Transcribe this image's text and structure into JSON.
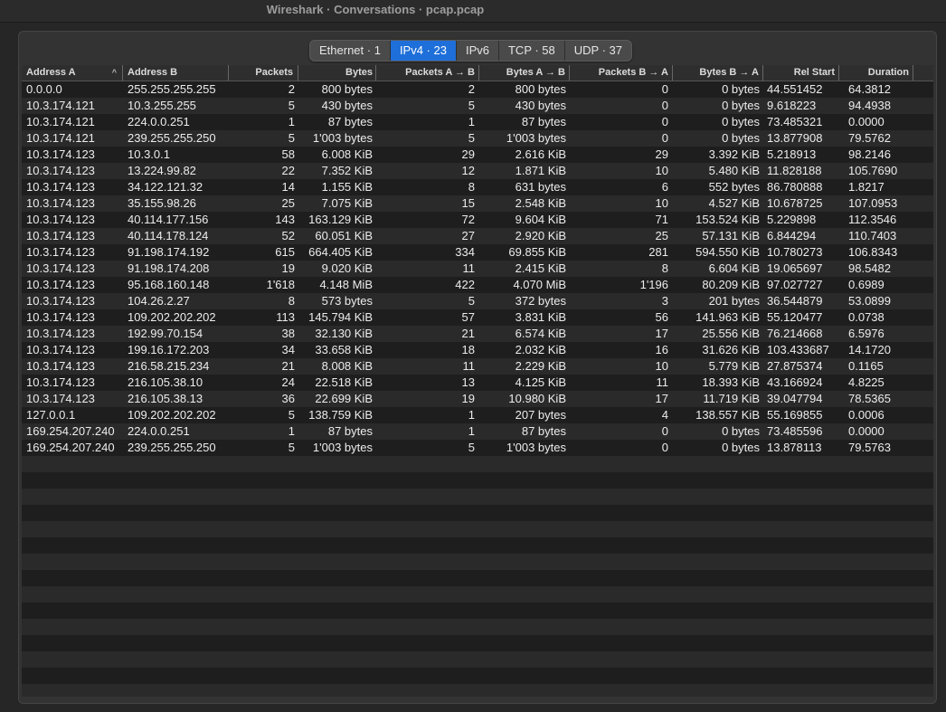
{
  "window": {
    "title": "Wireshark · Conversations · pcap.pcap"
  },
  "tabs": [
    {
      "label": "Ethernet · 1",
      "active": false
    },
    {
      "label": "IPv4 · 23",
      "active": true
    },
    {
      "label": "IPv6",
      "active": false
    },
    {
      "label": "TCP · 58",
      "active": false
    },
    {
      "label": "UDP · 37",
      "active": false
    }
  ],
  "colors": {
    "accent": "#1e6fd9",
    "row_odd": "#1e1e1e",
    "row_even": "#2a2a2a"
  },
  "table": {
    "sort_indicator": "^",
    "columns": [
      "Address A",
      "Address B",
      "Packets",
      "Bytes",
      "Packets A → B",
      "Bytes A → B",
      "Packets B → A",
      "Bytes B → A",
      "Rel Start",
      "Duration"
    ],
    "rows": [
      [
        "0.0.0.0",
        "255.255.255.255",
        "2",
        "800 bytes",
        "2",
        "800 bytes",
        "0",
        "0 bytes",
        "44.551452",
        "64.3812"
      ],
      [
        "10.3.174.121",
        "10.3.255.255",
        "5",
        "430 bytes",
        "5",
        "430 bytes",
        "0",
        "0 bytes",
        "9.618223",
        "94.4938"
      ],
      [
        "10.3.174.121",
        "224.0.0.251",
        "1",
        "87 bytes",
        "1",
        "87 bytes",
        "0",
        "0 bytes",
        "73.485321",
        "0.0000"
      ],
      [
        "10.3.174.121",
        "239.255.255.250",
        "5",
        "1'003 bytes",
        "5",
        "1'003 bytes",
        "0",
        "0 bytes",
        "13.877908",
        "79.5762"
      ],
      [
        "10.3.174.123",
        "10.3.0.1",
        "58",
        "6.008 KiB",
        "29",
        "2.616 KiB",
        "29",
        "3.392 KiB",
        "5.218913",
        "98.2146"
      ],
      [
        "10.3.174.123",
        "13.224.99.82",
        "22",
        "7.352 KiB",
        "12",
        "1.871 KiB",
        "10",
        "5.480 KiB",
        "11.828188",
        "105.7690"
      ],
      [
        "10.3.174.123",
        "34.122.121.32",
        "14",
        "1.155 KiB",
        "8",
        "631 bytes",
        "6",
        "552 bytes",
        "86.780888",
        "1.8217"
      ],
      [
        "10.3.174.123",
        "35.155.98.26",
        "25",
        "7.075 KiB",
        "15",
        "2.548 KiB",
        "10",
        "4.527 KiB",
        "10.678725",
        "107.0953"
      ],
      [
        "10.3.174.123",
        "40.114.177.156",
        "143",
        "163.129 KiB",
        "72",
        "9.604 KiB",
        "71",
        "153.524 KiB",
        "5.229898",
        "112.3546"
      ],
      [
        "10.3.174.123",
        "40.114.178.124",
        "52",
        "60.051 KiB",
        "27",
        "2.920 KiB",
        "25",
        "57.131 KiB",
        "6.844294",
        "110.7403"
      ],
      [
        "10.3.174.123",
        "91.198.174.192",
        "615",
        "664.405 KiB",
        "334",
        "69.855 KiB",
        "281",
        "594.550 KiB",
        "10.780273",
        "106.8343"
      ],
      [
        "10.3.174.123",
        "91.198.174.208",
        "19",
        "9.020 KiB",
        "11",
        "2.415 KiB",
        "8",
        "6.604 KiB",
        "19.065697",
        "98.5482"
      ],
      [
        "10.3.174.123",
        "95.168.160.148",
        "1'618",
        "4.148 MiB",
        "422",
        "4.070 MiB",
        "1'196",
        "80.209 KiB",
        "97.027727",
        "0.6989"
      ],
      [
        "10.3.174.123",
        "104.26.2.27",
        "8",
        "573 bytes",
        "5",
        "372 bytes",
        "3",
        "201 bytes",
        "36.544879",
        "53.0899"
      ],
      [
        "10.3.174.123",
        "109.202.202.202",
        "113",
        "145.794 KiB",
        "57",
        "3.831 KiB",
        "56",
        "141.963 KiB",
        "55.120477",
        "0.0738"
      ],
      [
        "10.3.174.123",
        "192.99.70.154",
        "38",
        "32.130 KiB",
        "21",
        "6.574 KiB",
        "17",
        "25.556 KiB",
        "76.214668",
        "6.5976"
      ],
      [
        "10.3.174.123",
        "199.16.172.203",
        "34",
        "33.658 KiB",
        "18",
        "2.032 KiB",
        "16",
        "31.626 KiB",
        "103.433687",
        "14.1720"
      ],
      [
        "10.3.174.123",
        "216.58.215.234",
        "21",
        "8.008 KiB",
        "11",
        "2.229 KiB",
        "10",
        "5.779 KiB",
        "27.875374",
        "0.1165"
      ],
      [
        "10.3.174.123",
        "216.105.38.10",
        "24",
        "22.518 KiB",
        "13",
        "4.125 KiB",
        "11",
        "18.393 KiB",
        "43.166924",
        "4.8225"
      ],
      [
        "10.3.174.123",
        "216.105.38.13",
        "36",
        "22.699 KiB",
        "19",
        "10.980 KiB",
        "17",
        "11.719 KiB",
        "39.047794",
        "78.5365"
      ],
      [
        "127.0.0.1",
        "109.202.202.202",
        "5",
        "138.759 KiB",
        "1",
        "207 bytes",
        "4",
        "138.557 KiB",
        "55.169855",
        "0.0006"
      ],
      [
        "169.254.207.240",
        "224.0.0.251",
        "1",
        "87 bytes",
        "1",
        "87 bytes",
        "0",
        "0 bytes",
        "73.485596",
        "0.0000"
      ],
      [
        "169.254.207.240",
        "239.255.255.250",
        "5",
        "1'003 bytes",
        "5",
        "1'003 bytes",
        "0",
        "0 bytes",
        "13.878113",
        "79.5763"
      ]
    ]
  }
}
